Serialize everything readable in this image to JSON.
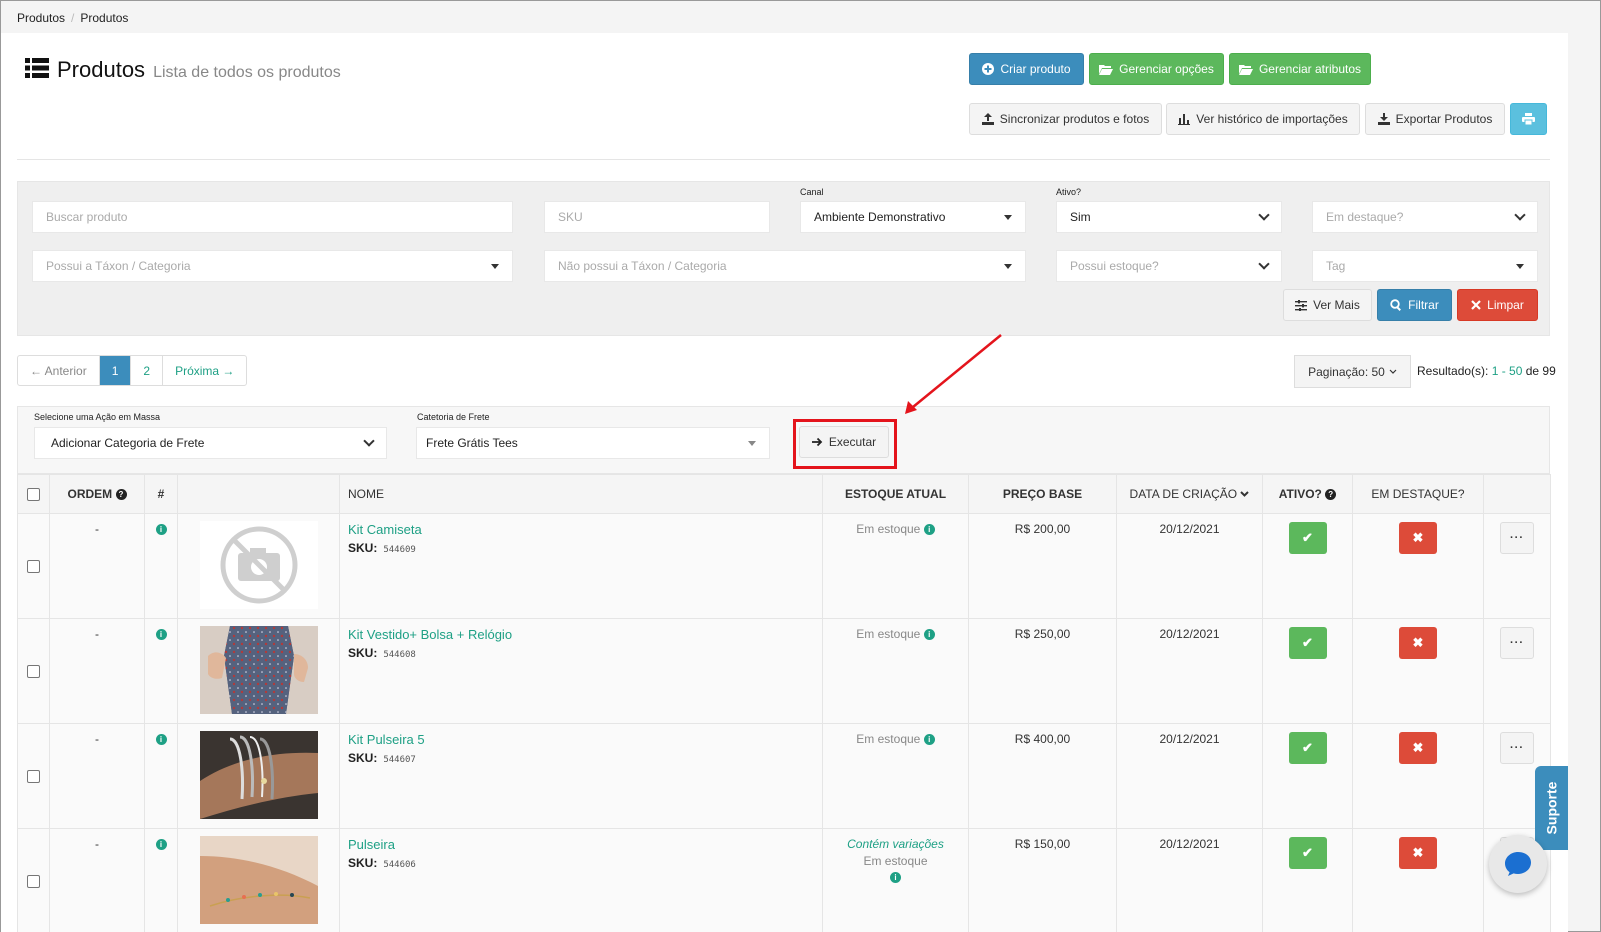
{
  "breadcrumb": [
    "Produtos",
    "Produtos"
  ],
  "header": {
    "title": "Produtos",
    "subtitle": "Lista de todos os produtos"
  },
  "actions": {
    "create": "Criar produto",
    "manage_options": "Gerenciar opções",
    "manage_attributes": "Gerenciar atributos",
    "sync": "Sincronizar produtos e fotos",
    "import_history": "Ver histórico de importações",
    "export": "Exportar Produtos"
  },
  "filters": {
    "search_placeholder": "Buscar produto",
    "sku_placeholder": "SKU",
    "channel_label": "Canal",
    "channel_value": "Ambiente Demonstrativo",
    "active_label": "Ativo?",
    "active_value": "Sim",
    "featured_placeholder": "Em destaque?",
    "has_taxon_placeholder": "Possui a Táxon / Categoria",
    "not_taxon_placeholder": "Não possui a Táxon / Categoria",
    "has_stock_placeholder": "Possui estoque?",
    "tag_placeholder": "Tag",
    "more": "Ver Mais",
    "filter": "Filtrar",
    "clear": "Limpar"
  },
  "pagination": {
    "prev": "← Anterior",
    "pages": [
      "1",
      "2"
    ],
    "next": "Próxima →",
    "per_page": "Paginação: 50",
    "results_label": "Resultado(s):",
    "results_range": "1 - 50",
    "results_total": "de 99"
  },
  "mass_action": {
    "label": "Selecione uma Ação em Massa",
    "value": "Adicionar Categoria de Frete",
    "shipping_label": "Catetoria de Frete",
    "shipping_value": "Frete Grátis Tees",
    "execute": "Executar"
  },
  "table": {
    "headers": {
      "order": "ORDEM",
      "hash": "#",
      "name": "NOME",
      "stock": "ESTOQUE ATUAL",
      "price": "PREÇO BASE",
      "created": "DATA DE CRIAÇÃO",
      "active": "ATIVO?",
      "featured": "EM DESTAQUE?"
    },
    "rows": [
      {
        "order": "-",
        "name": "Kit Camiseta",
        "sku_label": "SKU:",
        "sku": "544609",
        "variation": "",
        "stock": "Em estoque",
        "price": "R$ 200,00",
        "date": "20/12/2021"
      },
      {
        "order": "-",
        "name": "Kit Vestido+ Bolsa + Relógio",
        "sku_label": "SKU:",
        "sku": "544608",
        "variation": "",
        "stock": "Em estoque",
        "price": "R$ 250,00",
        "date": "20/12/2021"
      },
      {
        "order": "-",
        "name": "Kit Pulseira 5",
        "sku_label": "SKU:",
        "sku": "544607",
        "variation": "",
        "stock": "Em estoque",
        "price": "R$ 400,00",
        "date": "20/12/2021"
      },
      {
        "order": "-",
        "name": "Pulseira",
        "sku_label": "SKU:",
        "sku": "544606",
        "variation": "Contém variações",
        "stock": "Em estoque",
        "price": "R$ 150,00",
        "date": "20/12/2021"
      }
    ]
  },
  "support": "Suporte",
  "colors": {
    "primary": "#3c8dbc",
    "success": "#5cb85c",
    "danger": "#dd4b39",
    "link": "#1ea085",
    "highlight": "#e4141c"
  }
}
